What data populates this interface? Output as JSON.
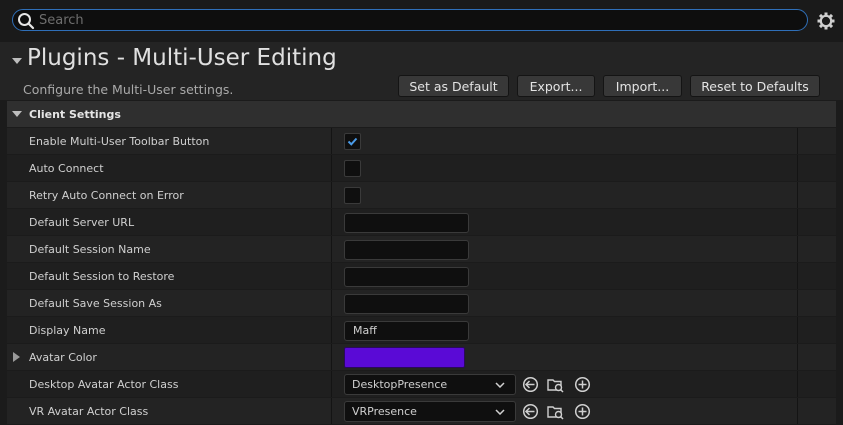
{
  "search": {
    "placeholder": "Search"
  },
  "page": {
    "title": "Plugins - Multi-User Editing",
    "subtitle": "Configure the Multi-User settings."
  },
  "buttons": {
    "set_default": "Set as Default",
    "export": "Export...",
    "import": "Import...",
    "reset": "Reset to Defaults"
  },
  "section": {
    "label": "Client Settings"
  },
  "rows": {
    "toolbar_button": {
      "label": "Enable Multi-User Toolbar Button",
      "checked": true
    },
    "auto_connect": {
      "label": "Auto Connect",
      "checked": false
    },
    "retry_auto_connect": {
      "label": "Retry Auto Connect on Error",
      "checked": false
    },
    "server_url": {
      "label": "Default Server URL",
      "value": ""
    },
    "session_name": {
      "label": "Default Session Name",
      "value": ""
    },
    "session_restore": {
      "label": "Default Session to Restore",
      "value": ""
    },
    "save_session_as": {
      "label": "Default Save Session As",
      "value": ""
    },
    "display_name": {
      "label": "Display Name",
      "value": "Maff"
    },
    "avatar_color": {
      "label": "Avatar Color",
      "color": "#5a0ad6"
    },
    "desktop_avatar": {
      "label": "Desktop Avatar Actor Class",
      "value": "DesktopPresence"
    },
    "vr_avatar": {
      "label": "VR Avatar Actor Class",
      "value": "VRPresence"
    }
  },
  "colors": {
    "accent": "#2f6fb8",
    "checkmark": "#4a9be8",
    "avatar": "#5a0ad6"
  },
  "icons": [
    "search-icon",
    "gear-icon",
    "collapse-arrow-icon",
    "expand-arrow-icon",
    "checkmark-icon",
    "chevron-down-icon",
    "use-selected-icon",
    "browse-icon",
    "clear-icon"
  ]
}
